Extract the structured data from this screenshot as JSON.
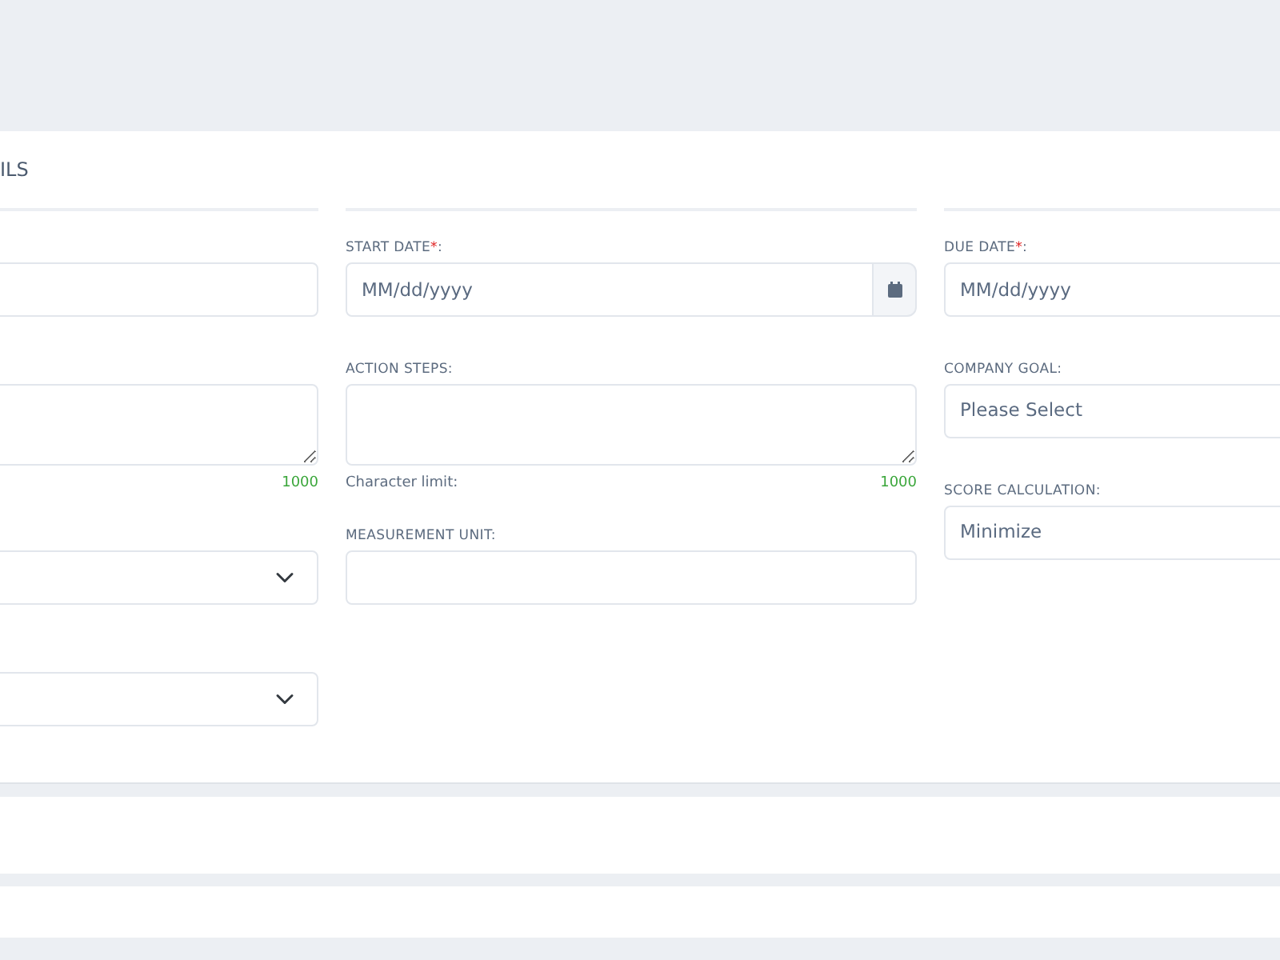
{
  "section": {
    "title": "ILS"
  },
  "columns": [
    {
      "fields": [
        {
          "kind": "text"
        },
        {
          "kind": "textarea",
          "counter": "1000"
        },
        {
          "kind": "select"
        },
        {
          "kind": "select"
        }
      ]
    },
    {
      "fields": [
        {
          "kind": "date",
          "label": "START DATE",
          "required_mark": "*",
          "label_end": ":",
          "placeholder": "MM/dd/yyyy",
          "calendar_button": true
        },
        {
          "kind": "textarea",
          "label": "ACTION STEPS:",
          "limit_label": "Character limit:",
          "counter": "1000"
        },
        {
          "kind": "text",
          "label": "MEASUREMENT UNIT:"
        }
      ]
    },
    {
      "fields": [
        {
          "kind": "date",
          "label": "DUE DATE",
          "required_mark": "*",
          "label_end": ":",
          "placeholder": "MM/dd/yyyy"
        },
        {
          "kind": "select",
          "label": "COMPANY GOAL:",
          "value": "Please Select"
        },
        {
          "kind": "select",
          "label": "SCORE CALCULATION:",
          "value": "Minimize"
        }
      ]
    }
  ],
  "lower_panels": [
    {
      "kind": "blank"
    },
    {
      "kind": "blank"
    }
  ]
}
